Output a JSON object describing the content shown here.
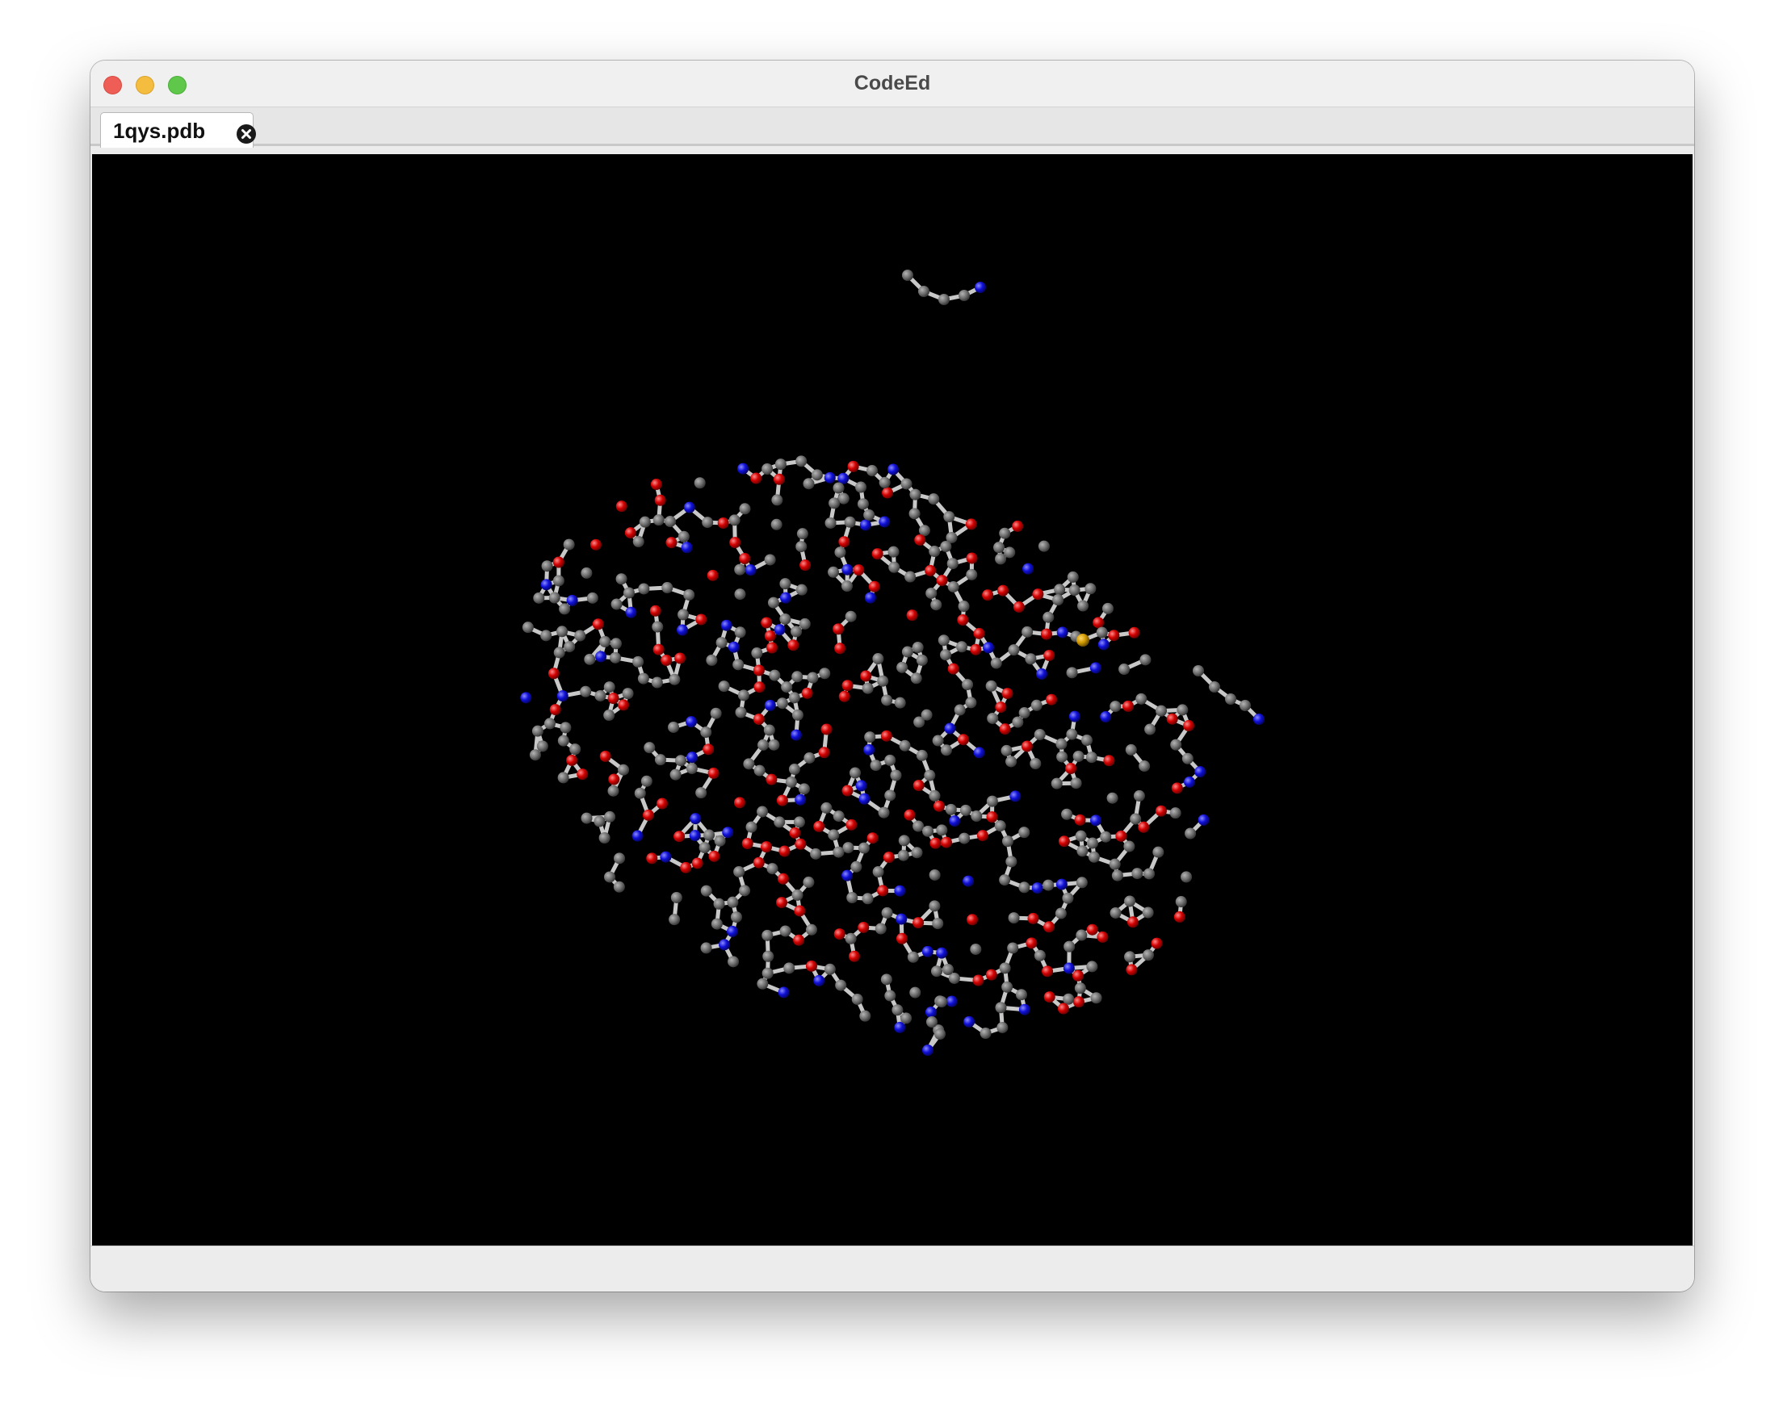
{
  "window": {
    "title": "CodeEd",
    "controls": [
      "close-icon",
      "minimize-icon",
      "zoom-icon"
    ]
  },
  "tabs": [
    {
      "label": "1qys.pdb",
      "active": true,
      "close_icon": "close-circle-icon"
    }
  ],
  "viewer": {
    "content": "molecular-structure-ball-and-stick",
    "background": "#000000",
    "atom_colors": {
      "carbon": "#6e6e6e",
      "oxygen": "#d20000",
      "nitrogen": "#1010d8",
      "sulfur": "#d29a00"
    },
    "bond_color": "#c8c8c8"
  },
  "colors": {
    "close": "#ee5e57",
    "minimize": "#f4bd3f",
    "zoom": "#5fc84b"
  }
}
